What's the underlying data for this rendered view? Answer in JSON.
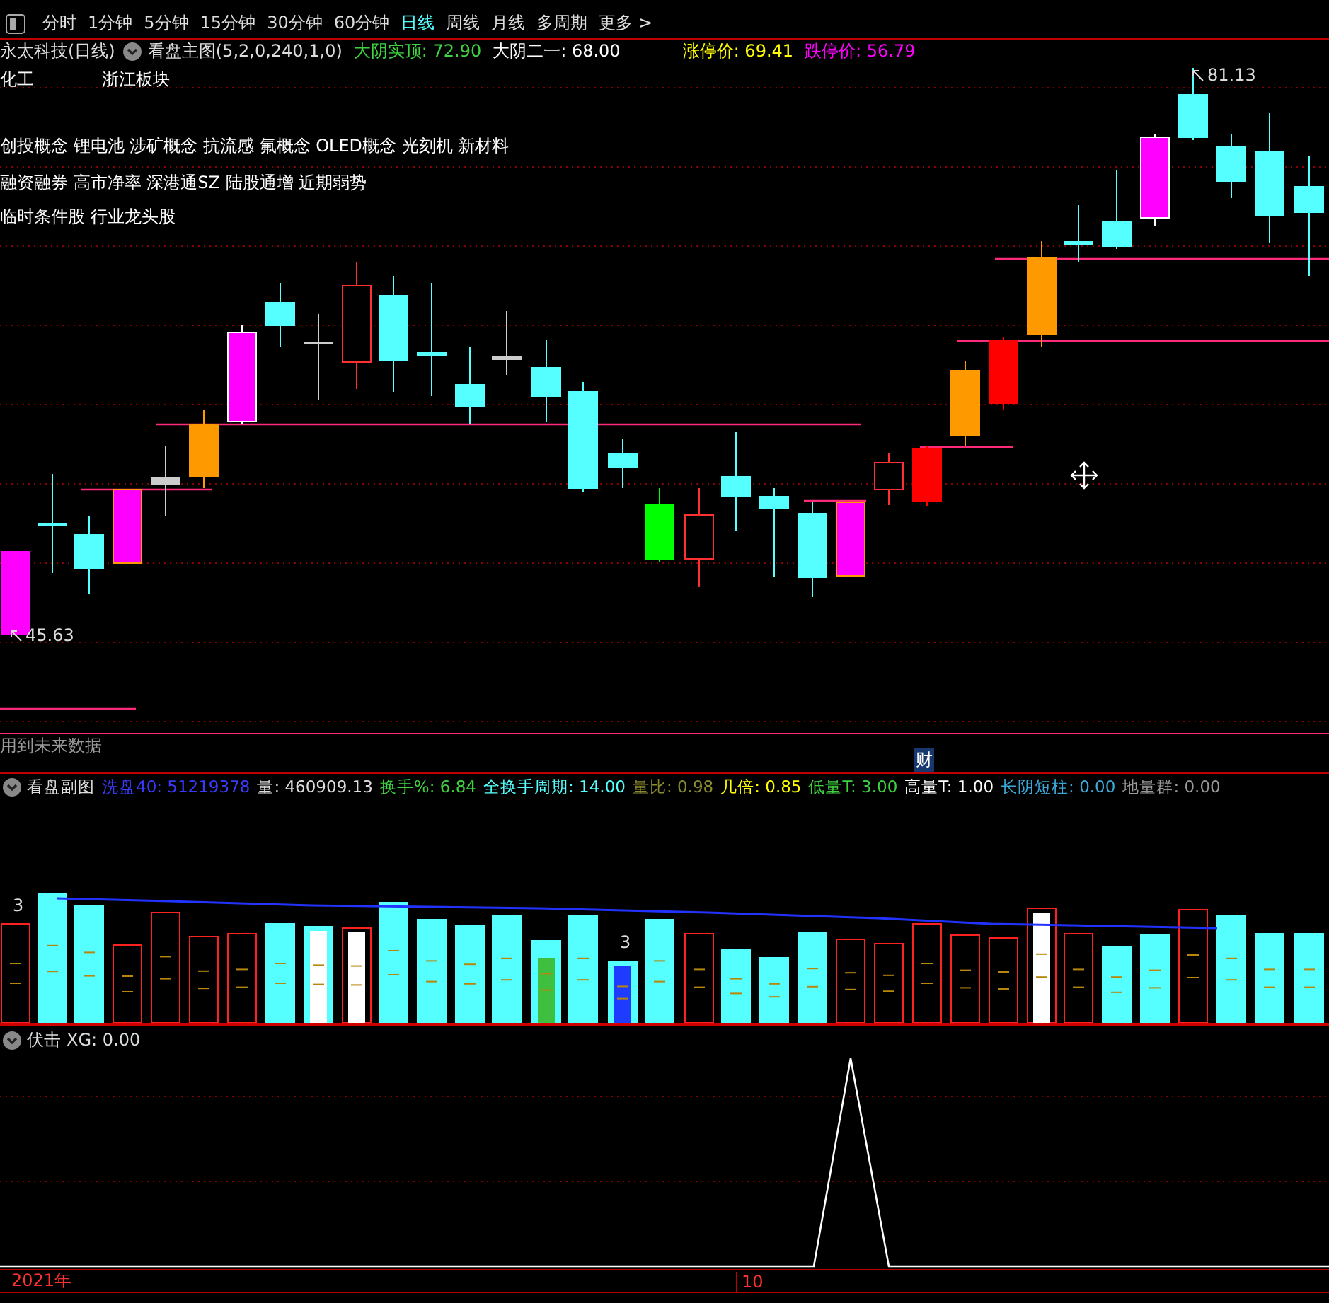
{
  "toolbar": {
    "periods": [
      {
        "label": "分时",
        "selected": false
      },
      {
        "label": "1分钟",
        "selected": false
      },
      {
        "label": "5分钟",
        "selected": false
      },
      {
        "label": "15分钟",
        "selected": false
      },
      {
        "label": "30分钟",
        "selected": false
      },
      {
        "label": "60分钟",
        "selected": false
      },
      {
        "label": "日线",
        "selected": true
      },
      {
        "label": "周线",
        "selected": false
      },
      {
        "label": "月线",
        "selected": false
      },
      {
        "label": "多周期",
        "selected": false
      },
      {
        "label": "更多 >",
        "selected": false
      }
    ]
  },
  "main_header": {
    "stock": "永太科技(日线)",
    "indicator": "看盘主图(5,2,0,240,1,0)",
    "values": [
      {
        "text": "大阴实顶: 72.90",
        "color": "#3fd23f"
      },
      {
        "text": "大阴二一: 68.00",
        "color": "#ffffff"
      },
      {
        "text": "涨停价: 69.41",
        "color": "#ffff00"
      },
      {
        "text": "跌停价: 56.79",
        "color": "#ff00ff"
      }
    ]
  },
  "main_chart": {
    "sector": "化工",
    "region": "浙江板块",
    "concept_lines": [
      "创投概念 锂电池 涉矿概念 抗流感 氟概念 OLED概念 光刻机 新材料",
      "融资融券 高市净率 深港通SZ 陆股通增 近期弱势",
      "临时条件股 行业龙头股"
    ],
    "high_label": "81.13",
    "low_label": "45.63"
  },
  "notice": {
    "text": "用到未来数据",
    "badge": "财"
  },
  "sub_header": {
    "title": "看盘副图",
    "values": [
      {
        "text": "洗盘40: 51219378",
        "color": "#3a3aff"
      },
      {
        "text": "量: 460909.13",
        "color": "#dddddd"
      },
      {
        "text": "换手%: 6.84",
        "color": "#3fd23f"
      },
      {
        "text": "全换手周期: 14.00",
        "color": "#55ffff"
      },
      {
        "text": "量比: 0.98",
        "color": "#8a8a30"
      },
      {
        "text": "几倍: 0.85",
        "color": "#ffff00"
      },
      {
        "text": "低量T: 3.00",
        "color": "#3fd23f"
      },
      {
        "text": "高量T: 1.00",
        "color": "#ffffff"
      },
      {
        "text": "长阴短柱: 0.00",
        "color": "#3aa8d8"
      },
      {
        "text": "地量群: 0.00",
        "color": "#9a9a9a"
      }
    ]
  },
  "sub_chart": {
    "markers": [
      "3",
      "3"
    ]
  },
  "signal_header": {
    "title": "伏击",
    "value": "XG: 0.00"
  },
  "axis": {
    "labels": [
      "2021年",
      "10"
    ]
  }
}
